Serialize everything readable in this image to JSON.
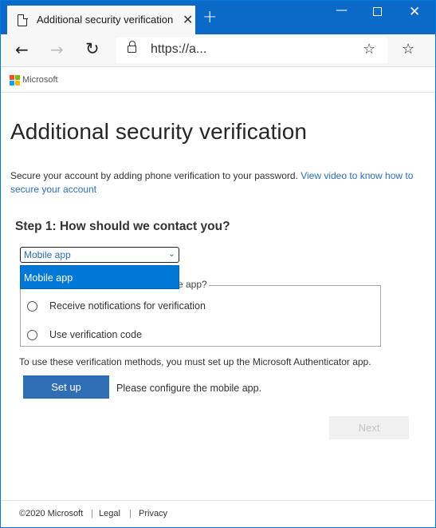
{
  "browser": {
    "tab_title": "Additional security verification",
    "tab_close": "✕",
    "new_tab": "+",
    "url": "https://a...",
    "icons": [
      "page-icon",
      "close-icon",
      "new-tab-icon",
      "minimize-icon",
      "maximize-icon",
      "close-window-icon",
      "back-icon",
      "forward-icon",
      "refresh-icon",
      "lock-icon",
      "favorite-star-icon",
      "favorites-icon"
    ]
  },
  "brand": {
    "name": "Microsoft",
    "logo_colors": [
      "#f25022",
      "#7fba00",
      "#00a4ef",
      "#ffb900"
    ]
  },
  "main": {
    "title": "Additional security verification",
    "intro_text": "Secure your account by adding phone verification to your password. ",
    "intro_link": "View video to know how to secure your account",
    "step_heading": "Step 1: How should we contact you?",
    "contact_method": {
      "selected": "Mobile app",
      "options": [
        "Mobile app"
      ],
      "highlighted_option": "Mobile app"
    },
    "question_tail": "e app?",
    "radio_options": [
      {
        "label": "Receive notifications for verification",
        "checked": false
      },
      {
        "label": "Use verification code",
        "checked": false
      }
    ],
    "note": "To use these verification methods, you must set up the Microsoft Authenticator app.",
    "setup_button": "Set up",
    "setup_note": "Please configure the mobile app.",
    "next_button": "Next"
  },
  "footer": {
    "copyright": "©2020 Microsoft",
    "separator": "|",
    "legal": "Legal",
    "privacy": "Privacy"
  },
  "colors": {
    "accent": "#0078d7",
    "link": "#2f6eb5",
    "button": "#2f6eb5",
    "titlebar": "#0b69c7"
  }
}
